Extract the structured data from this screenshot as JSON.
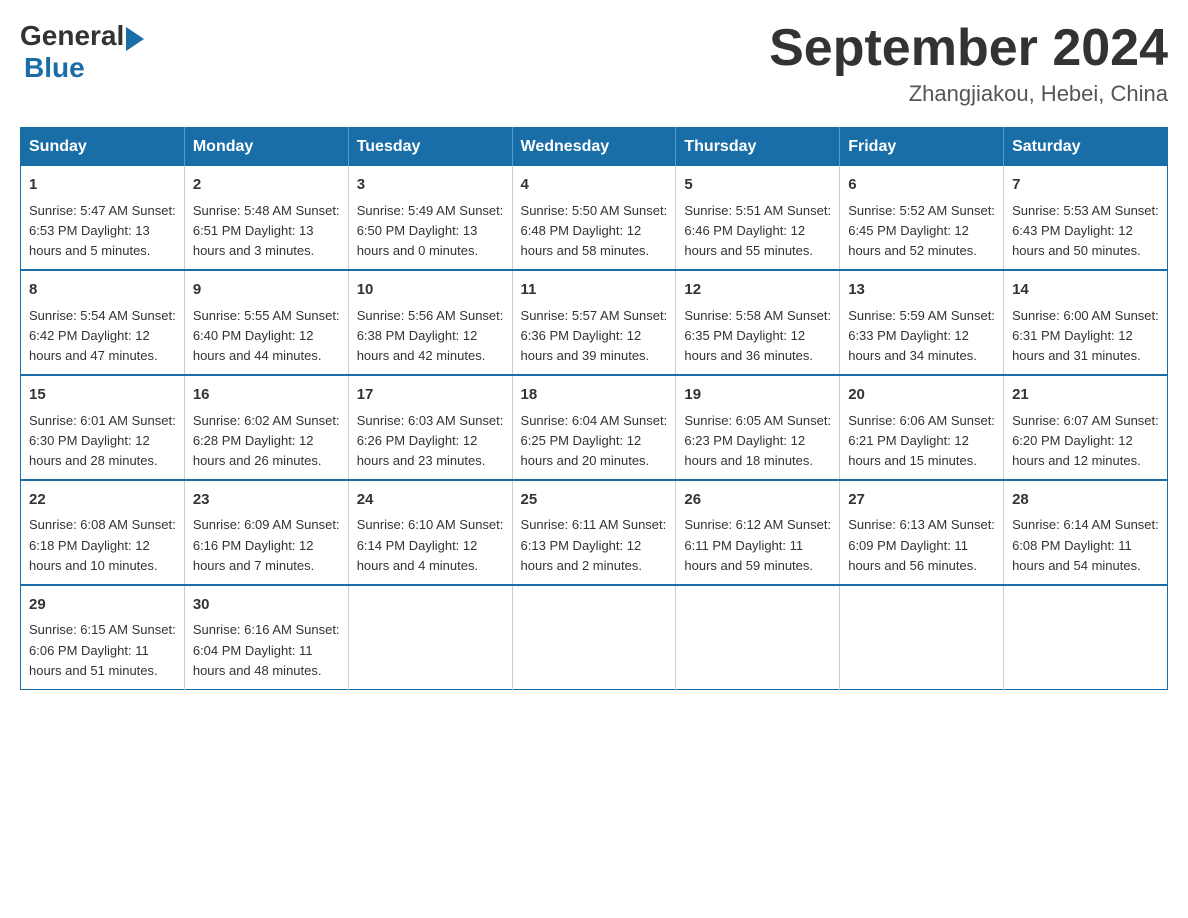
{
  "header": {
    "logo_general": "General",
    "logo_blue": "Blue",
    "month_title": "September 2024",
    "location": "Zhangjiakou, Hebei, China"
  },
  "calendar": {
    "days_of_week": [
      "Sunday",
      "Monday",
      "Tuesday",
      "Wednesday",
      "Thursday",
      "Friday",
      "Saturday"
    ],
    "weeks": [
      [
        {
          "day": "",
          "info": ""
        },
        {
          "day": "",
          "info": ""
        },
        {
          "day": "",
          "info": ""
        },
        {
          "day": "",
          "info": ""
        },
        {
          "day": "",
          "info": ""
        },
        {
          "day": "",
          "info": ""
        },
        {
          "day": "",
          "info": ""
        }
      ],
      [
        {
          "day": "1",
          "info": "Sunrise: 5:47 AM\nSunset: 6:53 PM\nDaylight: 13 hours\nand 5 minutes."
        },
        {
          "day": "2",
          "info": "Sunrise: 5:48 AM\nSunset: 6:51 PM\nDaylight: 13 hours\nand 3 minutes."
        },
        {
          "day": "3",
          "info": "Sunrise: 5:49 AM\nSunset: 6:50 PM\nDaylight: 13 hours\nand 0 minutes."
        },
        {
          "day": "4",
          "info": "Sunrise: 5:50 AM\nSunset: 6:48 PM\nDaylight: 12 hours\nand 58 minutes."
        },
        {
          "day": "5",
          "info": "Sunrise: 5:51 AM\nSunset: 6:46 PM\nDaylight: 12 hours\nand 55 minutes."
        },
        {
          "day": "6",
          "info": "Sunrise: 5:52 AM\nSunset: 6:45 PM\nDaylight: 12 hours\nand 52 minutes."
        },
        {
          "day": "7",
          "info": "Sunrise: 5:53 AM\nSunset: 6:43 PM\nDaylight: 12 hours\nand 50 minutes."
        }
      ],
      [
        {
          "day": "8",
          "info": "Sunrise: 5:54 AM\nSunset: 6:42 PM\nDaylight: 12 hours\nand 47 minutes."
        },
        {
          "day": "9",
          "info": "Sunrise: 5:55 AM\nSunset: 6:40 PM\nDaylight: 12 hours\nand 44 minutes."
        },
        {
          "day": "10",
          "info": "Sunrise: 5:56 AM\nSunset: 6:38 PM\nDaylight: 12 hours\nand 42 minutes."
        },
        {
          "day": "11",
          "info": "Sunrise: 5:57 AM\nSunset: 6:36 PM\nDaylight: 12 hours\nand 39 minutes."
        },
        {
          "day": "12",
          "info": "Sunrise: 5:58 AM\nSunset: 6:35 PM\nDaylight: 12 hours\nand 36 minutes."
        },
        {
          "day": "13",
          "info": "Sunrise: 5:59 AM\nSunset: 6:33 PM\nDaylight: 12 hours\nand 34 minutes."
        },
        {
          "day": "14",
          "info": "Sunrise: 6:00 AM\nSunset: 6:31 PM\nDaylight: 12 hours\nand 31 minutes."
        }
      ],
      [
        {
          "day": "15",
          "info": "Sunrise: 6:01 AM\nSunset: 6:30 PM\nDaylight: 12 hours\nand 28 minutes."
        },
        {
          "day": "16",
          "info": "Sunrise: 6:02 AM\nSunset: 6:28 PM\nDaylight: 12 hours\nand 26 minutes."
        },
        {
          "day": "17",
          "info": "Sunrise: 6:03 AM\nSunset: 6:26 PM\nDaylight: 12 hours\nand 23 minutes."
        },
        {
          "day": "18",
          "info": "Sunrise: 6:04 AM\nSunset: 6:25 PM\nDaylight: 12 hours\nand 20 minutes."
        },
        {
          "day": "19",
          "info": "Sunrise: 6:05 AM\nSunset: 6:23 PM\nDaylight: 12 hours\nand 18 minutes."
        },
        {
          "day": "20",
          "info": "Sunrise: 6:06 AM\nSunset: 6:21 PM\nDaylight: 12 hours\nand 15 minutes."
        },
        {
          "day": "21",
          "info": "Sunrise: 6:07 AM\nSunset: 6:20 PM\nDaylight: 12 hours\nand 12 minutes."
        }
      ],
      [
        {
          "day": "22",
          "info": "Sunrise: 6:08 AM\nSunset: 6:18 PM\nDaylight: 12 hours\nand 10 minutes."
        },
        {
          "day": "23",
          "info": "Sunrise: 6:09 AM\nSunset: 6:16 PM\nDaylight: 12 hours\nand 7 minutes."
        },
        {
          "day": "24",
          "info": "Sunrise: 6:10 AM\nSunset: 6:14 PM\nDaylight: 12 hours\nand 4 minutes."
        },
        {
          "day": "25",
          "info": "Sunrise: 6:11 AM\nSunset: 6:13 PM\nDaylight: 12 hours\nand 2 minutes."
        },
        {
          "day": "26",
          "info": "Sunrise: 6:12 AM\nSunset: 6:11 PM\nDaylight: 11 hours\nand 59 minutes."
        },
        {
          "day": "27",
          "info": "Sunrise: 6:13 AM\nSunset: 6:09 PM\nDaylight: 11 hours\nand 56 minutes."
        },
        {
          "day": "28",
          "info": "Sunrise: 6:14 AM\nSunset: 6:08 PM\nDaylight: 11 hours\nand 54 minutes."
        }
      ],
      [
        {
          "day": "29",
          "info": "Sunrise: 6:15 AM\nSunset: 6:06 PM\nDaylight: 11 hours\nand 51 minutes."
        },
        {
          "day": "30",
          "info": "Sunrise: 6:16 AM\nSunset: 6:04 PM\nDaylight: 11 hours\nand 48 minutes."
        },
        {
          "day": "",
          "info": ""
        },
        {
          "day": "",
          "info": ""
        },
        {
          "day": "",
          "info": ""
        },
        {
          "day": "",
          "info": ""
        },
        {
          "day": "",
          "info": ""
        }
      ]
    ]
  }
}
